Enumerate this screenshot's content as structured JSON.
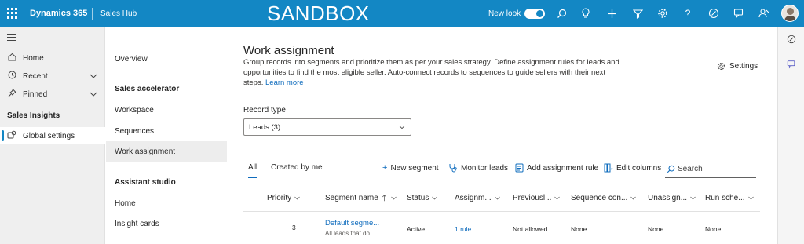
{
  "topbar": {
    "app_name": "Dynamics 365",
    "hub_name": "Sales Hub",
    "environment_banner": "SANDBOX",
    "new_look_label": "New look",
    "new_look_enabled": true
  },
  "leftnav": {
    "items": [
      {
        "label": "Home",
        "icon": "home-icon"
      },
      {
        "label": "Recent",
        "icon": "clock-icon"
      },
      {
        "label": "Pinned",
        "icon": "pin-icon"
      }
    ],
    "group_label": "Sales Insights",
    "selected_item": {
      "label": "Global settings",
      "icon": "settings-gear-icon"
    }
  },
  "settings_nav": {
    "overview": "Overview",
    "sales_accelerator_heading": "Sales accelerator",
    "workspace": "Workspace",
    "sequences": "Sequences",
    "work_assignment": "Work assignment",
    "assistant_studio_heading": "Assistant studio",
    "home": "Home",
    "insight_cards": "Insight cards"
  },
  "main": {
    "title": "Work assignment",
    "description": "Group records into segments and prioritize them as per your sales strategy. Define assignment rules for leads and opportunities to find the most eligible seller. Auto-connect records to sequences to guide sellers with their next steps.",
    "learn_more": "Learn more",
    "settings_label": "Settings",
    "record_type_label": "Record type",
    "record_type_value": "Leads (3)",
    "tabs": [
      "All",
      "Created by me"
    ],
    "commands": {
      "new_segment": "New segment",
      "monitor_leads": "Monitor leads",
      "add_assignment_rule": "Add assignment rule",
      "edit_columns": "Edit columns"
    },
    "search_placeholder": "Search",
    "columns": [
      "Priority",
      "Segment name",
      "Status",
      "Assignm...",
      "Previousl...",
      "Sequence con...",
      "Unassign...",
      "Run sche..."
    ],
    "rows": [
      {
        "priority": "3",
        "segment_name": "Default segme...",
        "segment_desc": "All leads that do...",
        "status": "Active",
        "assignment": "1 rule",
        "previously": "Not allowed",
        "sequence": "None",
        "unassign": "None",
        "run_schedule": "None"
      }
    ]
  },
  "colors": {
    "brand": "#1387c4",
    "link": "#0f6cbd",
    "selected_bg": "#ededed"
  }
}
